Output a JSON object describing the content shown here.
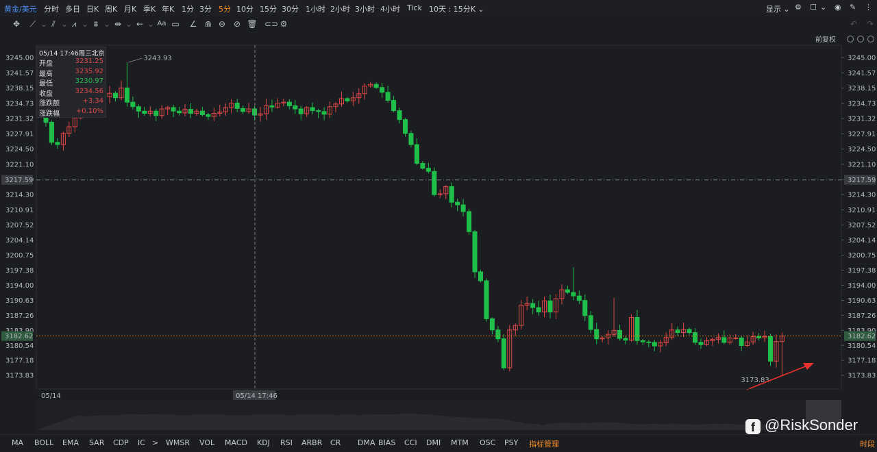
{
  "topbar": {
    "symbol": "黄金/美元",
    "periods": [
      "分时",
      "多日",
      "日K",
      "周K",
      "月K",
      "季K",
      "年K",
      "1分",
      "3分",
      "5分",
      "10分",
      "15分",
      "30分",
      "1小时",
      "2小时",
      "3小时",
      "4小时",
      "Tick"
    ],
    "active_period": "5分",
    "range_select": "10天 : 15分K",
    "display_label": "显示"
  },
  "right_header": {
    "adjust_label": "前复权"
  },
  "info": {
    "datetime": "05/14 17:46周三北京",
    "rows": [
      {
        "key": "开盘",
        "value": "3231.25",
        "color": "#e04848"
      },
      {
        "key": "最高",
        "value": "3235.92",
        "color": "#e04848"
      },
      {
        "key": "最低",
        "value": "3230.97",
        "color": "#1fbf4a"
      },
      {
        "key": "收盘",
        "value": "3234.56",
        "color": "#e04848"
      },
      {
        "key": "涨跌额",
        "value": "+3.34",
        "color": "#e04848"
      },
      {
        "key": "涨跌幅",
        "value": "+0.10%",
        "color": "#e04848"
      }
    ]
  },
  "annotations": {
    "high_label": "3243.93",
    "low_label": "3173.83"
  },
  "crosshair": {
    "price_label": "3217.59",
    "time_label": "05/14 17:46"
  },
  "current_price": "3182.62",
  "x_axis": {
    "start_label": "05/14"
  },
  "colors": {
    "up": "#e04848",
    "down": "#1fbf4a",
    "accent": "#f08a24",
    "link": "#4d8ff0"
  },
  "chart_data": {
    "type": "candlestick",
    "y_ticks": [
      "3245.00",
      "3241.57",
      "3238.15",
      "3234.73",
      "3231.32",
      "3227.91",
      "3224.50",
      "3221.10",
      "3217.69",
      "3214.30",
      "3210.91",
      "3207.52",
      "3204.14",
      "3200.75",
      "3197.38",
      "3194.00",
      "3190.63",
      "3187.26",
      "3183.90",
      "3180.54",
      "3177.18",
      "3173.83"
    ],
    "ylim": [
      3172,
      3247
    ],
    "closes": [
      3230.5,
      3226,
      3225.5,
      3228,
      3229.5,
      3231.5,
      3233,
      3232.5,
      3236,
      3238,
      3236.2,
      3237,
      3236,
      3238.2,
      3235,
      3234,
      3233,
      3232.5,
      3233,
      3232,
      3233.5,
      3233.8,
      3233,
      3232.6,
      3233.4,
      3232.5,
      3233,
      3232.2,
      3231.8,
      3232.5,
      3232.8,
      3233.8,
      3234.8,
      3233.6,
      3232.9,
      3233.5,
      3232.1,
      3232.4,
      3234.2,
      3233.9,
      3234.8,
      3235,
      3234.2,
      3233.5,
      3232.4,
      3233.8,
      3233.1,
      3232.9,
      3232.3,
      3234,
      3234.6,
      3235.8,
      3235.3,
      3236,
      3236.9,
      3238.6,
      3239,
      3238.3,
      3237.2,
      3235.4,
      3233.1,
      3231.1,
      3228,
      3225.5,
      3221.3,
      3220.2,
      3219.5,
      3214.3,
      3214.5,
      3216.1,
      3212.6,
      3212,
      3210.5,
      3206,
      3197,
      3195,
      3186.5,
      3184,
      3182,
      3175.5,
      3184,
      3185,
      3189.5,
      3189.9,
      3189,
      3188,
      3190.5,
      3188,
      3191,
      3193,
      3192.4,
      3191.6,
      3190.6,
      3187.2,
      3184.1,
      3182,
      3182.2,
      3183,
      3183.9,
      3182.1,
      3181.7,
      3186.8,
      3181.6,
      3181.3,
      3181.2,
      3180.4,
      3181.1,
      3182.3,
      3184,
      3183.4,
      3184.1,
      3183.4,
      3181.2,
      3180.7,
      3181.6,
      3181.9,
      3182.3,
      3181.2,
      3182.2,
      3182.2,
      3180.5,
      3181.3,
      3182.5,
      3182.2,
      3182.5,
      3177,
      3181.4,
      3182.6
    ]
  },
  "bottom_tabs": [
    "MA",
    "BOLL",
    "EMA",
    "SAR",
    "CDP",
    "IC",
    ">",
    "WMSR",
    "VOL",
    "MACD",
    "KDJ",
    "RSI",
    "ARBR",
    "CR",
    "DMA",
    "BIAS",
    "CCI",
    "DMI",
    "MTM",
    "OSC",
    "PSY",
    "指标管理"
  ],
  "bottom_right": "时段",
  "watermark": "@RiskSonder"
}
